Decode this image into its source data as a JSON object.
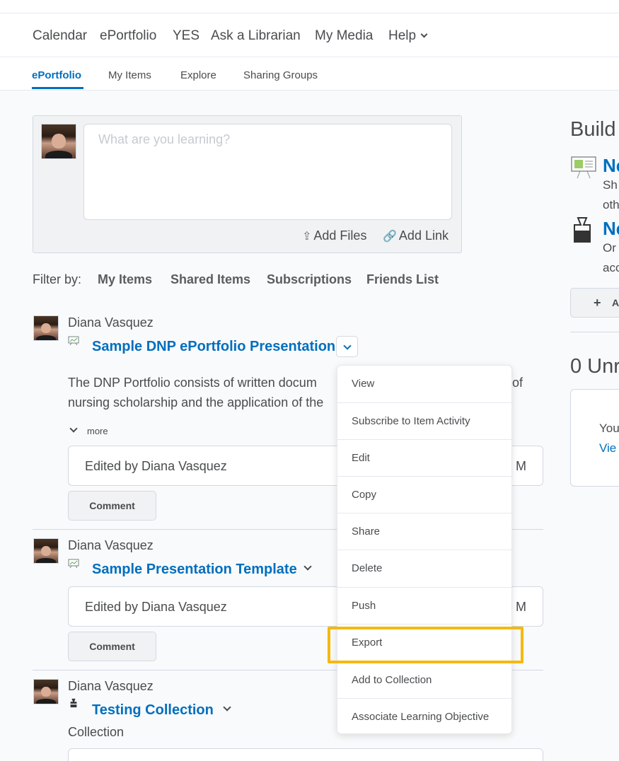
{
  "top_nav": {
    "items": [
      "Calendar",
      "ePortfolio",
      "YES",
      "Ask a Librarian",
      "My Media"
    ],
    "help_label": "Help"
  },
  "sub_nav": {
    "tabs": [
      "ePortfolio",
      "My Items",
      "Explore",
      "Sharing Groups"
    ],
    "active": "ePortfolio"
  },
  "composer": {
    "placeholder": "What are you learning?",
    "add_files": "Add Files",
    "add_link": "Add Link"
  },
  "filter": {
    "label": "Filter by:",
    "options": [
      "My Items",
      "Shared Items",
      "Subscriptions",
      "Friends List"
    ]
  },
  "posts": [
    {
      "author": "Diana Vasquez",
      "title": "Sample DNP ePortfolio Presentation",
      "icon": "presentation-icon",
      "desc_line1_left": "The DNP Portfolio consists of written docum",
      "desc_line1_right": "of",
      "desc_line2": "nursing scholarship and the application of the",
      "more_label": "more",
      "edited": "Edited by Diana Vasquez",
      "edited_time_tail": "M",
      "comment_label": "Comment"
    },
    {
      "author": "Diana Vasquez",
      "title": "Sample Presentation Template",
      "icon": "presentation-icon",
      "edited": "Edited by Diana Vasquez",
      "edited_time_tail": "M",
      "comment_label": "Comment"
    },
    {
      "author": "Diana Vasquez",
      "title": "Testing Collection",
      "icon": "collection-icon",
      "subtitle": "Collection"
    }
  ],
  "right": {
    "heading": "Build",
    "link1": "Ne",
    "link1_text": [
      "Sh",
      "oth"
    ],
    "link2": "Ne",
    "link2_text": [
      "Or",
      "acc"
    ],
    "add_label": "A",
    "unread_heading": "0 Unr",
    "panel_text": "You",
    "panel_link": "Vie"
  },
  "menu": {
    "items": [
      "View",
      "Subscribe to Item Activity",
      "Edit",
      "Copy",
      "Share",
      "Delete",
      "Push",
      "Export",
      "Add to Collection",
      "Associate Learning Objective"
    ],
    "highlighted": "Export"
  },
  "colors": {
    "brand": "#006fbf",
    "highlight": "#f5b90f",
    "text": "#494c4e"
  }
}
